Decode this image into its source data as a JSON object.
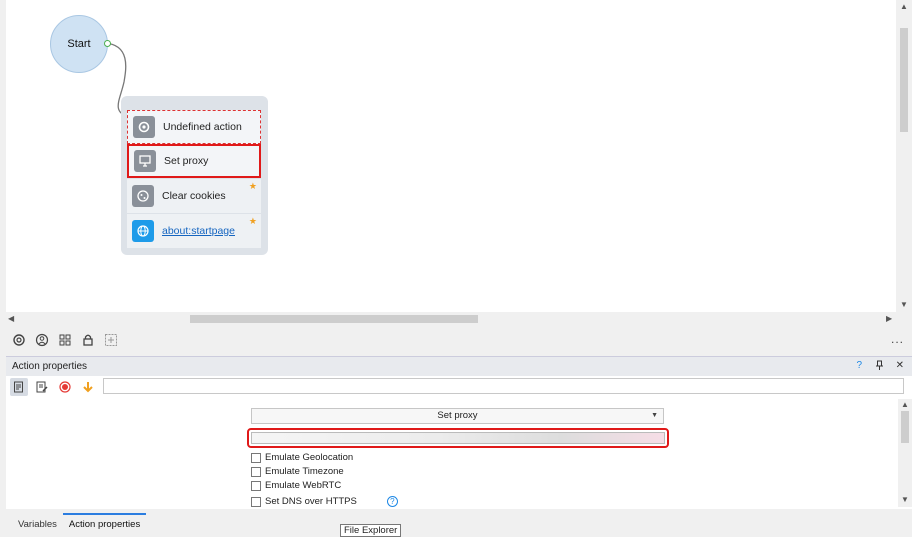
{
  "canvas": {
    "start_label": "Start",
    "actions": [
      {
        "label": "Undefined action",
        "icon": "gear-icon"
      },
      {
        "label": "Set proxy",
        "icon": "monitor-icon"
      },
      {
        "label": "Clear cookies",
        "icon": "cookie-icon",
        "star": "★"
      },
      {
        "label": "about:startpage",
        "icon": "globe-icon",
        "star": "★"
      }
    ]
  },
  "toolbar": {
    "icons": [
      "settings-icon",
      "user-icon",
      "grid-icon",
      "lock-icon",
      "add-icon"
    ],
    "more": "..."
  },
  "panel": {
    "title": "Action properties",
    "help": "?",
    "pin": "📌",
    "close": "✕",
    "tools": [
      "notes-icon",
      "edit-notes-icon",
      "record-icon",
      "arrow-down-icon"
    ],
    "search_value": "",
    "select_value": "Set proxy",
    "checkboxes": [
      {
        "label": "Emulate Geolocation",
        "checked": false
      },
      {
        "label": "Emulate Timezone",
        "checked": false
      },
      {
        "label": "Emulate WebRTC",
        "checked": false
      },
      {
        "label": "Set DNS over HTTPS",
        "checked": false
      }
    ],
    "help_glyph": "?"
  },
  "tabs": [
    {
      "label": "Variables",
      "active": false
    },
    {
      "label": "Action properties",
      "active": true
    }
  ],
  "tooltip": "File Explorer",
  "colors": {
    "accent": "#2b7de0",
    "highlight": "#e01919",
    "star": "#f0a020",
    "link": "#1565c0"
  }
}
